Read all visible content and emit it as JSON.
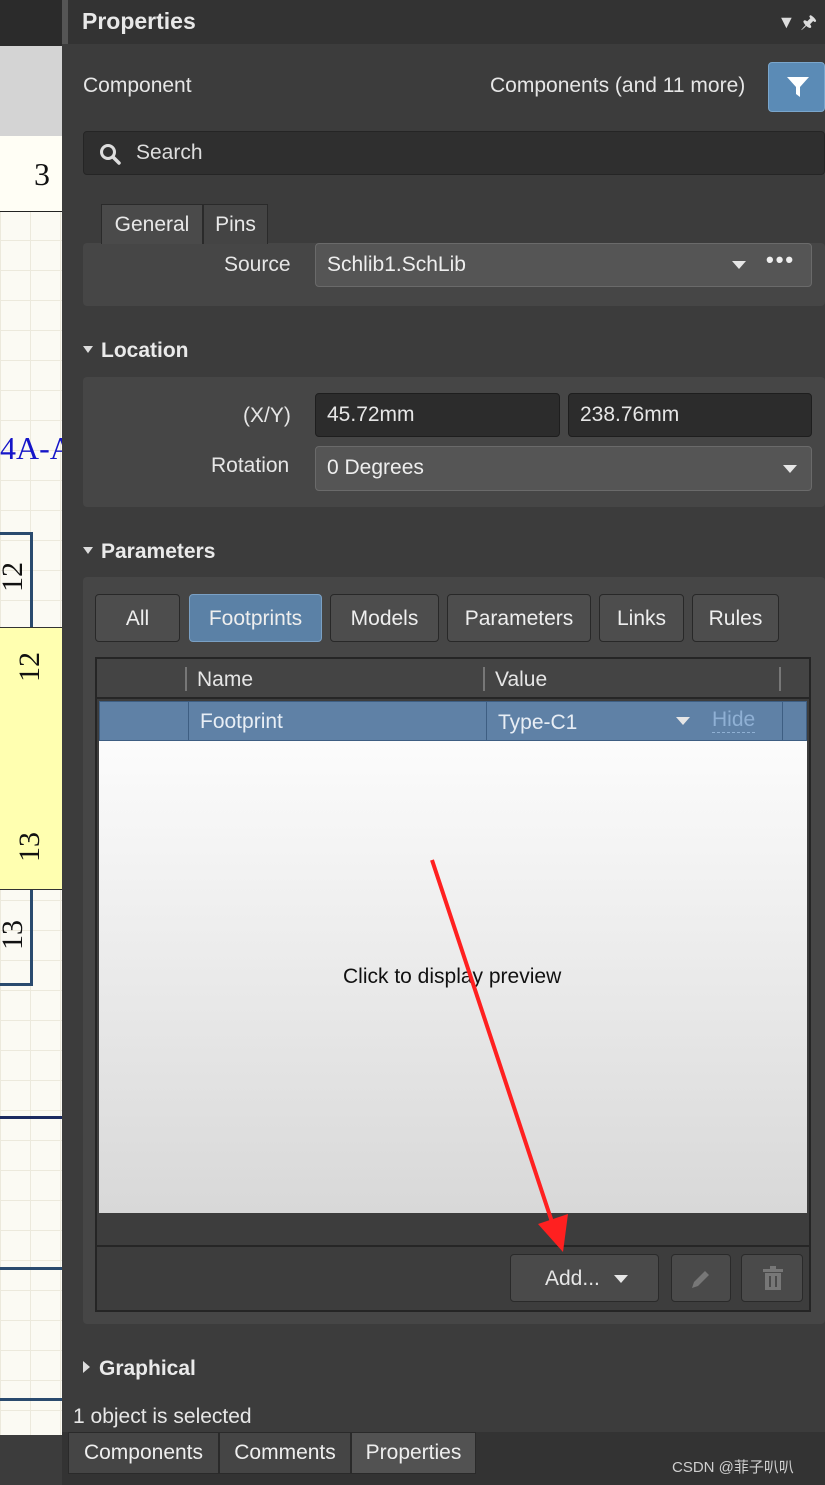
{
  "schematic": {
    "cell_top": "3",
    "part_label": "4A-A",
    "pin_12": "12",
    "pin_13": "13"
  },
  "panel": {
    "title": "Properties",
    "component_label": "Component",
    "component_filter": "Components (and 11 more)",
    "search_placeholder": "Search",
    "tabs": [
      "General",
      "Pins"
    ],
    "source_label": "Source",
    "source_value": "Schlib1.SchLib",
    "location": {
      "heading": "Location",
      "xy_label": "(X/Y)",
      "x": "45.72mm",
      "y": "238.76mm",
      "rotation_label": "Rotation",
      "rotation": "0 Degrees"
    },
    "parameters": {
      "heading": "Parameters",
      "filters": [
        "All",
        "Footprints",
        "Models",
        "Parameters",
        "Links",
        "Rules"
      ],
      "active_filter": "Footprints",
      "columns": {
        "name": "Name",
        "value": "Value"
      },
      "row": {
        "name": "Footprint",
        "value": "Type-C1",
        "hide": "Hide"
      },
      "preview_text": "Click to display preview",
      "add_label": "Add..."
    },
    "graphical_heading": "Graphical",
    "status": "1 object is selected",
    "bottom_tabs": [
      "Components",
      "Comments",
      "Properties"
    ],
    "watermark": "CSDN @菲子叭叭"
  },
  "colors": {
    "accent": "#5b81a6",
    "annotation_arrow": "#ff2020"
  }
}
